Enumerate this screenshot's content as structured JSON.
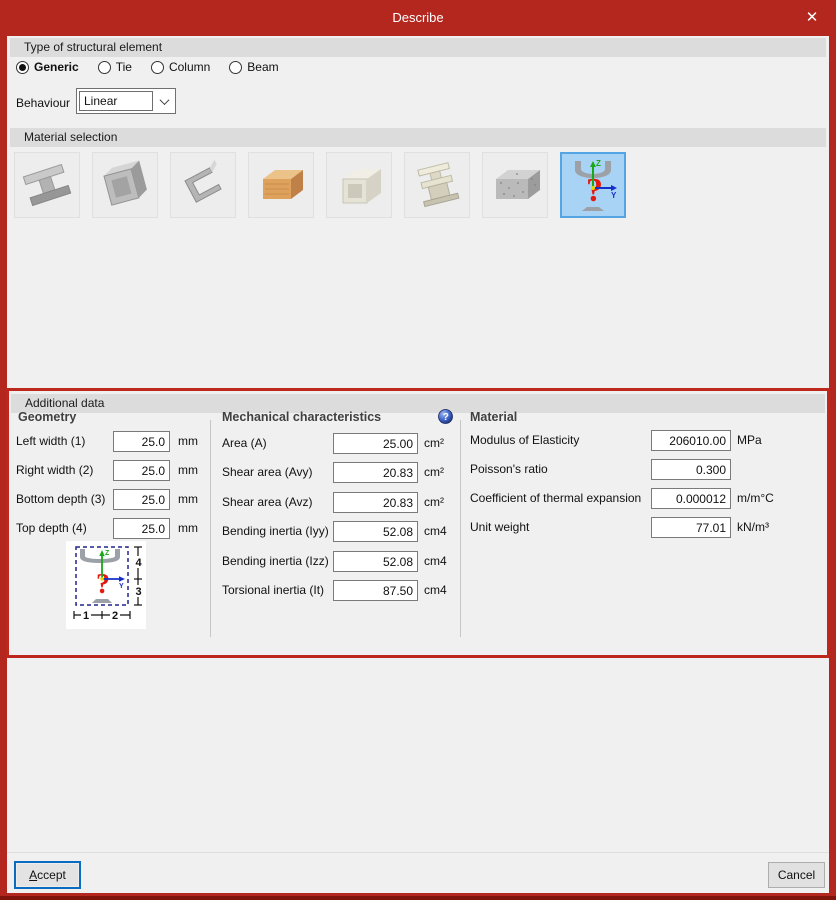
{
  "window": {
    "title": "Describe",
    "close_glyph": "✕"
  },
  "type_section": {
    "header": "Type of structural element",
    "options": [
      {
        "label": "Generic",
        "selected": true
      },
      {
        "label": "Tie",
        "selected": false
      },
      {
        "label": "Column",
        "selected": false
      },
      {
        "label": "Beam",
        "selected": false
      }
    ]
  },
  "behaviour": {
    "label": "Behaviour",
    "value": "Linear"
  },
  "material_selection": {
    "header": "Material selection",
    "tiles": [
      {
        "name": "rolled-steel"
      },
      {
        "name": "welded-steel"
      },
      {
        "name": "cold-formed-steel"
      },
      {
        "name": "timber"
      },
      {
        "name": "pvc"
      },
      {
        "name": "aluminium"
      },
      {
        "name": "concrete"
      },
      {
        "name": "generic-section",
        "selected": true
      }
    ]
  },
  "additional_data": {
    "header": "Additional data",
    "geometry": {
      "title": "Geometry",
      "fields": [
        {
          "label": "Left width (1)",
          "value": "25.0",
          "unit": "mm"
        },
        {
          "label": "Right width (2)",
          "value": "25.0",
          "unit": "mm"
        },
        {
          "label": "Bottom depth (3)",
          "value": "25.0",
          "unit": "mm"
        },
        {
          "label": "Top depth (4)",
          "value": "25.0",
          "unit": "mm"
        }
      ],
      "diagram": {
        "axis_z": "Z",
        "axis_y": "Y",
        "qmark": "?",
        "dim1": "1",
        "dim2": "2",
        "dim3": "3",
        "dim4": "4"
      }
    },
    "mechanical": {
      "title": "Mechanical characteristics",
      "help_glyph": "?",
      "fields": [
        {
          "label": "Area (A)",
          "value": "25.00",
          "unit": "cm²"
        },
        {
          "label": "Shear area (Avy)",
          "value": "20.83",
          "unit": "cm²"
        },
        {
          "label": "Shear area (Avz)",
          "value": "20.83",
          "unit": "cm²"
        },
        {
          "label": "Bending inertia (Iyy)",
          "value": "52.08",
          "unit": "cm4"
        },
        {
          "label": "Bending inertia (Izz)",
          "value": "52.08",
          "unit": "cm4"
        },
        {
          "label": "Torsional inertia (It)",
          "value": "87.50",
          "unit": "cm4"
        }
      ]
    },
    "material": {
      "title": "Material",
      "fields": [
        {
          "label": "Modulus of Elasticity",
          "value": "206010.00",
          "unit": "MPa"
        },
        {
          "label": "Poisson's ratio",
          "value": "0.300",
          "unit": ""
        },
        {
          "label": "Coefficient of thermal expansion",
          "value": "0.000012",
          "unit": "m/m°C"
        },
        {
          "label": "Unit weight",
          "value": "77.01",
          "unit": "kN/m³"
        }
      ]
    }
  },
  "footer": {
    "accept_prefix": "A",
    "accept_rest": "ccept",
    "cancel_label": "Cancel"
  },
  "colors": {
    "titlebar_red": "#B3271E",
    "highlight_border_red": "#BE271C",
    "selected_tile_bg": "#A9D3F5",
    "selected_tile_border": "#55A4E4",
    "focus_blue": "#0A6CC0",
    "groupbar_gray": "#DCDCDC"
  }
}
